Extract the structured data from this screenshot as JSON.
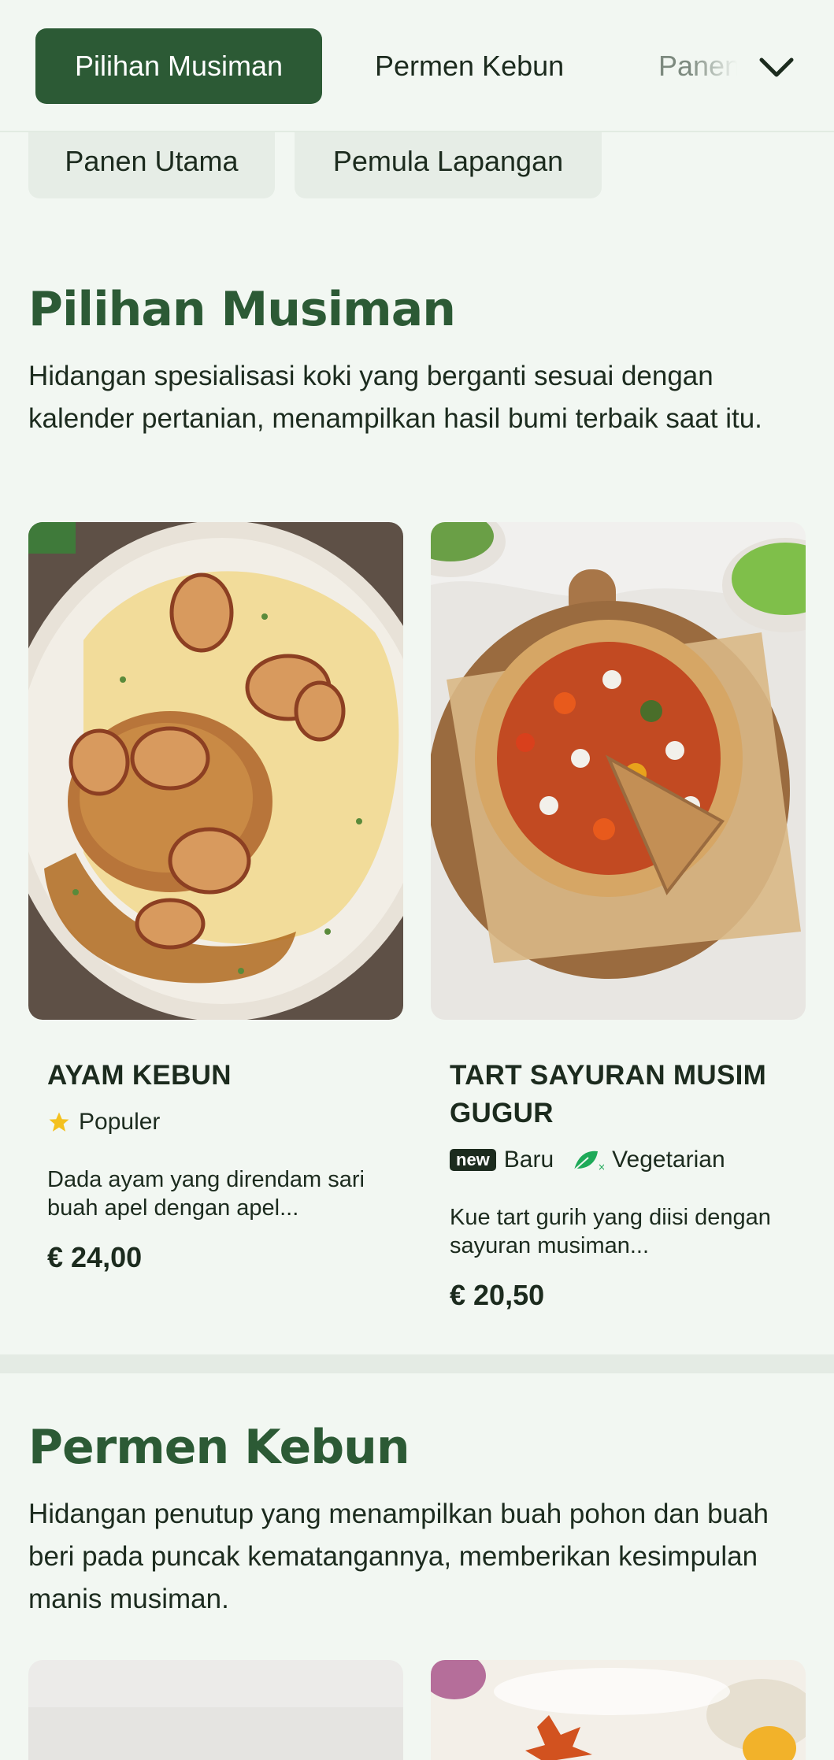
{
  "tabs": {
    "items": [
      {
        "label": "Pilihan Musiman",
        "active": true
      },
      {
        "label": "Permen Kebun",
        "active": false
      },
      {
        "label": "Panen Utama",
        "active": false
      }
    ],
    "overflow_chips": [
      "Panen Utama",
      "Pemula Lapangan"
    ],
    "toggle_icon": "chevron-down-icon"
  },
  "sections": [
    {
      "title": "Pilihan Musiman",
      "description": "Hidangan spesialisasi koki yang berganti sesuai dengan kalender pertanian, menampilkan hasil bumi terbaik saat itu.",
      "items": [
        {
          "name": "Ayam Kebun",
          "tags": [
            {
              "icon": "star-icon",
              "label": "Populer"
            }
          ],
          "description": "Dada ayam yang direndam sari buah apel dengan apel...",
          "price": "€ 24,00"
        },
        {
          "name": "Tart Sayuran Musim Gugur",
          "tags": [
            {
              "badge": "new",
              "label": "Baru"
            },
            {
              "icon": "leaf-icon",
              "label": "Vegetarian"
            }
          ],
          "description": "Kue tart gurih yang diisi dengan sayuran musiman...",
          "price": "€ 20,50"
        }
      ]
    },
    {
      "title": "Permen Kebun",
      "description": "Hidangan penutup yang menampilkan buah pohon dan buah beri pada puncak kematangannya, memberikan kesimpulan manis musiman."
    }
  ],
  "colors": {
    "brand_green": "#2c5a35",
    "background": "#f2f7f2",
    "star": "#f4c11f",
    "leaf": "#1faa59"
  }
}
